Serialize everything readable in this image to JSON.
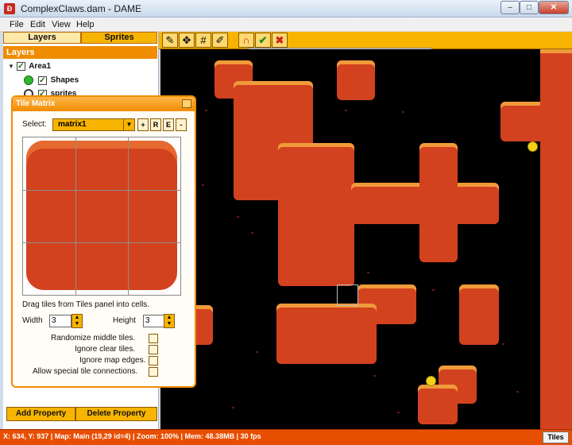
{
  "window": {
    "title": "ComplexClaws.dam - DAME",
    "icon": "dame-app-icon",
    "min_label": "–",
    "max_label": "□",
    "close_label": "✕"
  },
  "menu": {
    "items": [
      "File",
      "Edit",
      "View",
      "Help"
    ]
  },
  "left_panel": {
    "tabs": {
      "layers": "Layers",
      "sprites": "Sprites",
      "active": "Layers"
    },
    "header": "Layers",
    "tree": {
      "area": "Area1",
      "shapes": "Shapes",
      "sprites": "sprites"
    },
    "buttons": {
      "add_property": "Add Property",
      "delete_property": "Delete Property"
    }
  },
  "toolbar": {
    "icons": [
      "brush-icon",
      "move-icon",
      "grid-icon",
      "pencil-icon",
      "magnet-icon",
      "check-icon",
      "cancel-icon"
    ]
  },
  "tile_matrix": {
    "title": "Tile Matrix",
    "select_label": "Select:",
    "selected": "matrix1",
    "small_buttons": [
      "R",
      "E",
      "-"
    ],
    "hint": "Drag tiles from Tiles panel into cells.",
    "width_label": "Width",
    "width_value": "3",
    "height_label": "Height",
    "height_value": "3",
    "options": [
      {
        "label": "Randomize middle tiles.",
        "checked": false
      },
      {
        "label": "Ignore clear tiles.",
        "checked": false
      },
      {
        "label": "Ignore map edges.",
        "checked": false
      },
      {
        "label": "Allow special tile connections.",
        "checked": false
      }
    ]
  },
  "status": {
    "text": "X: 634, Y: 937 | Map: Main (19,29 id=4) | Zoom: 100% | Mem: 48.38MB | 30 fps",
    "tiles_button": "Tiles"
  },
  "colors": {
    "accent": "#f7b400",
    "header_orange": "#f08c00",
    "status_orange": "#e84e00",
    "lava": "#d2421f"
  }
}
